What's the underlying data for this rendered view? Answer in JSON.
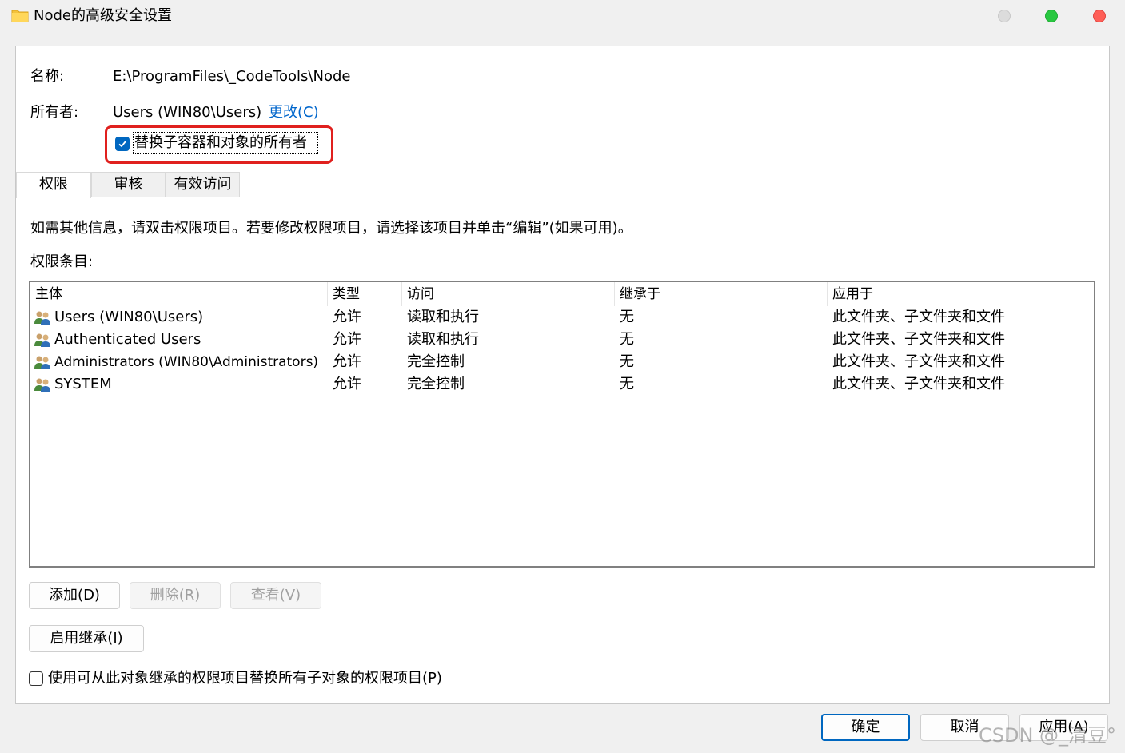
{
  "window": {
    "title": "Node的高级安全设置",
    "icon": "folder-icon"
  },
  "owner_section": {
    "name_label": "名称:",
    "name_value": "E:\\ProgramFiles\\_CodeTools\\Node",
    "owner_label": "所有者:",
    "owner_value": "Users (WIN80\\Users)",
    "change_link": "更改(C)",
    "replace_owner_checkbox": {
      "label": "替换子容器和对象的所有者",
      "checked": true
    }
  },
  "tabs": [
    {
      "label": "权限",
      "active": true
    },
    {
      "label": "审核",
      "active": false
    },
    {
      "label": "有效访问",
      "active": false
    }
  ],
  "info_text": "如需其他信息，请双击权限项目。若要修改权限项目，请选择该项目并单击“编辑”(如果可用)。",
  "entries_label": "权限条目:",
  "permissions_table": {
    "columns": [
      "主体",
      "类型",
      "访问",
      "继承于",
      "应用于"
    ],
    "rows": [
      {
        "principal": "Users (WIN80\\Users)",
        "type": "允许",
        "access": "读取和执行",
        "inherited_from": "无",
        "applies_to": "此文件夹、子文件夹和文件"
      },
      {
        "principal": "Authenticated Users",
        "type": "允许",
        "access": "读取和执行",
        "inherited_from": "无",
        "applies_to": "此文件夹、子文件夹和文件"
      },
      {
        "principal": "Administrators (WIN80\\Administrators)",
        "type": "允许",
        "access": "完全控制",
        "inherited_from": "无",
        "applies_to": "此文件夹、子文件夹和文件"
      },
      {
        "principal": "SYSTEM",
        "type": "允许",
        "access": "完全控制",
        "inherited_from": "无",
        "applies_to": "此文件夹、子文件夹和文件"
      }
    ]
  },
  "buttons": {
    "add": "添加(D)",
    "remove": "删除(R)",
    "view": "查看(V)",
    "enable_inheritance": "启用继承(I)",
    "ok": "确定",
    "cancel": "取消",
    "apply": "应用(A)"
  },
  "replace_child_checkbox": {
    "label": "使用可从此对象继承的权限项目替换所有子对象的权限项目(P)",
    "checked": false
  },
  "watermark": "CSDN @_清豆°",
  "colors": {
    "accent": "#0067c0",
    "highlight_border": "#e0201e",
    "link": "#0066cc"
  }
}
